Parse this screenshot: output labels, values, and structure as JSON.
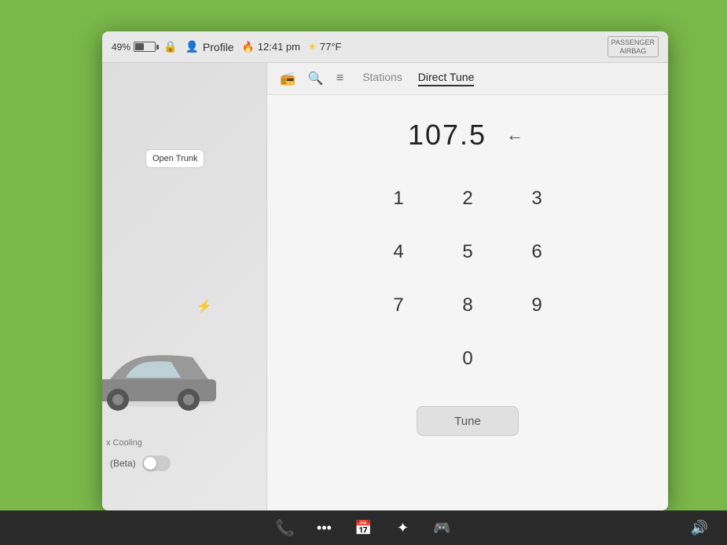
{
  "statusBar": {
    "battery": "49%",
    "profile": "Profile",
    "time": "12:41 pm",
    "temp": "77°F",
    "airbag": "PASSENGER\nAIRBAG"
  },
  "leftPanel": {
    "openTrunk": "Open\nTrunk",
    "beta": "(Beta)",
    "cooling": "x Cooling"
  },
  "radioToolbar": {
    "tabs": [
      {
        "label": "Stations",
        "active": false
      },
      {
        "label": "Direct Tune",
        "active": true
      }
    ]
  },
  "directTune": {
    "frequency": "107.5",
    "backspace": "←",
    "keys": [
      "1",
      "2",
      "3",
      "4",
      "5",
      "6",
      "7",
      "8",
      "9",
      "0"
    ],
    "tuneLabel": "Tune"
  },
  "taskbar": {
    "icons": [
      "phone",
      "dots",
      "calendar",
      "star",
      "game"
    ],
    "calendarDate": "8",
    "volume": "🔊"
  }
}
